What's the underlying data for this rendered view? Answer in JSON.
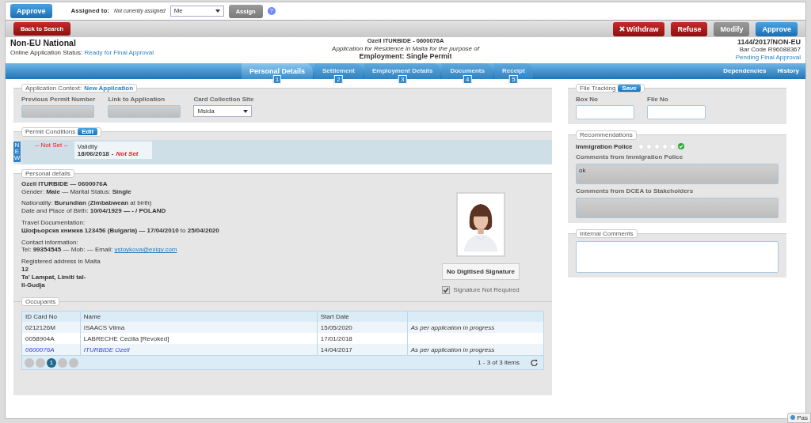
{
  "top_bar": {
    "approve_button": "Approve",
    "assigned_label": "Assigned to:",
    "assigned_value": "Not currently assigned",
    "assignee_select": "Me",
    "assign_button": "Assign",
    "help": "?"
  },
  "toolbar": {
    "back_button": "Back to Search",
    "actions": [
      {
        "label": "Withdraw",
        "kind": "withdraw"
      },
      {
        "label": "Refuse",
        "kind": "danger"
      },
      {
        "label": "Modify",
        "kind": "disabled"
      },
      {
        "label": "Approve",
        "kind": "primary"
      }
    ]
  },
  "header": {
    "title": "Non-EU National",
    "status_label": "Online Application Status:",
    "status_value": "Ready for Final Approval",
    "applicant": "Ozell ITURBIDE - 0600076A",
    "purpose": "Application for Residence in Malta for the purpose of",
    "permit_type": "Employment: Single Permit",
    "reference": "1144/2017/NON-EU",
    "bar_code": "Bar Code R96088367",
    "stage": "Pending Final Approval"
  },
  "tabs": [
    {
      "label": "Personal Details",
      "number": "1",
      "selected": true
    },
    {
      "label": "Settlement",
      "number": "2",
      "selected": false
    },
    {
      "label": "Employment Details",
      "number": "3",
      "selected": false
    },
    {
      "label": "Documents",
      "number": "4",
      "selected": false
    },
    {
      "label": "Receipt",
      "number": "5",
      "selected": false
    }
  ],
  "nav_links": [
    "Dependencies",
    "History"
  ],
  "application_context": {
    "legend": "Application Context:",
    "value": "New Application",
    "fields": [
      {
        "label": "Previous Permit Number",
        "kind": "disabled-input"
      },
      {
        "label": "Link to Application",
        "kind": "disabled-input"
      },
      {
        "label": "Card Collection Site",
        "kind": "select",
        "value": "Msida"
      }
    ]
  },
  "permit_conditions": {
    "legend": "Permit Conditions",
    "edit_button": "Edit",
    "new_badge": "NEW",
    "condition": "-- Not Set --",
    "validity_label": "Validity",
    "validity_from": "18/06/2018",
    "validity_separator": "-",
    "validity_to": "Not Set"
  },
  "personal_details": {
    "legend": "Personal details",
    "blocks": [
      [
        {
          "text": "Ozell ITURBIDE — 0600076A",
          "bold": true
        },
        {
          "text": "Gender: **Male** — Marital Status: **Single**",
          "bold": false
        }
      ],
      [
        {
          "text": "Nationality: **Burundian** (**Zimbabwean** at birth)",
          "bold": false
        },
        {
          "text": "Date and Place of Birth: **10/04/1929 — - / POLAND**",
          "bold": false
        }
      ],
      [
        {
          "text": "Travel Documentation:",
          "bold": false
        },
        {
          "text": "**Шофьорска книжка 123456 (Bulgaria) — 17/04/2010** to **25/04/2020**",
          "bold": false
        }
      ],
      [
        {
          "text": "Contact information:",
          "bold": false
        },
        {
          "text": "Tel: **99354545** — Mob: — Email:",
          "bold": false,
          "link": "ystoykova@exigy.com"
        }
      ],
      [
        {
          "text": "Registered address in Malta",
          "bold": false
        },
        {
          "text": "12",
          "bold": true
        },
        {
          "text": "Ta' Lampat, Limiti tal-",
          "bold": true
        },
        {
          "text": "Il-Gudja",
          "bold": true
        }
      ]
    ],
    "signature_box": "No Digitised Signature",
    "signature_not_required": {
      "label": "Signature Not Required",
      "checked": true,
      "disabled": true
    }
  },
  "occupants": {
    "legend": "Occupants",
    "columns": [
      "ID Card No",
      "Name",
      "Start Date"
    ],
    "rows": [
      {
        "cells": [
          "0212126M",
          "ISAACS Vilma",
          "15/05/2020",
          "As per application in progress"
        ],
        "current": false
      },
      {
        "cells": [
          "0058904A",
          "LABRECHE Cecilia [Revoked]",
          "17/01/2018"
        ],
        "current": false
      },
      {
        "cells": [
          "0600076A",
          "ITURBIDE Ozell",
          "14/04/2017",
          "As per application in progress"
        ],
        "current": true
      }
    ],
    "pager": [
      {
        "kind": "first"
      },
      {
        "kind": "prev"
      },
      {
        "kind": "page",
        "label": "1",
        "selected": true
      },
      {
        "kind": "next"
      },
      {
        "kind": "last"
      }
    ],
    "summary": "1 - 3 of 3 items"
  },
  "file_tracking": {
    "legend": "File Tracking",
    "save_button": "Save",
    "fields": [
      "Box No",
      "File No"
    ]
  },
  "recommendations": {
    "legend": "Recommendations",
    "agency": "Immigration Police",
    "stars": 0,
    "approved": true,
    "comments": [
      {
        "label": "Comments from Immigration Police",
        "value": "ok"
      },
      {
        "label": "Comments from DCEA to Stakeholders"
      }
    ]
  },
  "internal_comments": {
    "legend": "Internal Comments"
  },
  "corner_tab": "Pas"
}
